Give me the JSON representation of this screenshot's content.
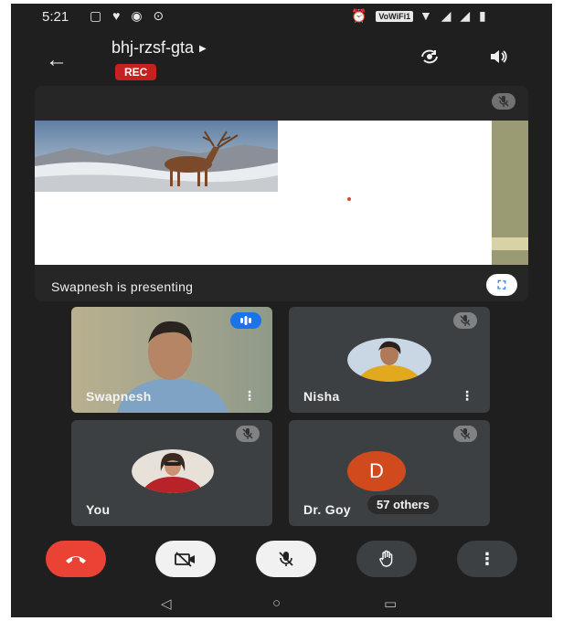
{
  "status_bar": {
    "time": "5:21",
    "wifi_tag": "VoWiFi1"
  },
  "header": {
    "meeting_code": "bhj-rzsf-gta",
    "rec_label": "REC"
  },
  "presentation": {
    "caption": "Swapnesh is presenting"
  },
  "participants": [
    {
      "name": "Swapnesh",
      "speaking": true
    },
    {
      "name": "Nisha",
      "muted": true
    },
    {
      "name": "You",
      "muted": true
    },
    {
      "name": "Dr. Goy",
      "initial": "D",
      "muted": true,
      "others_label": "57 others"
    }
  ],
  "colors": {
    "end_call": "#ea4335",
    "rec": "#c5221f",
    "speaking_badge": "#1a73e8",
    "avatar_d": "#d04a1e"
  }
}
